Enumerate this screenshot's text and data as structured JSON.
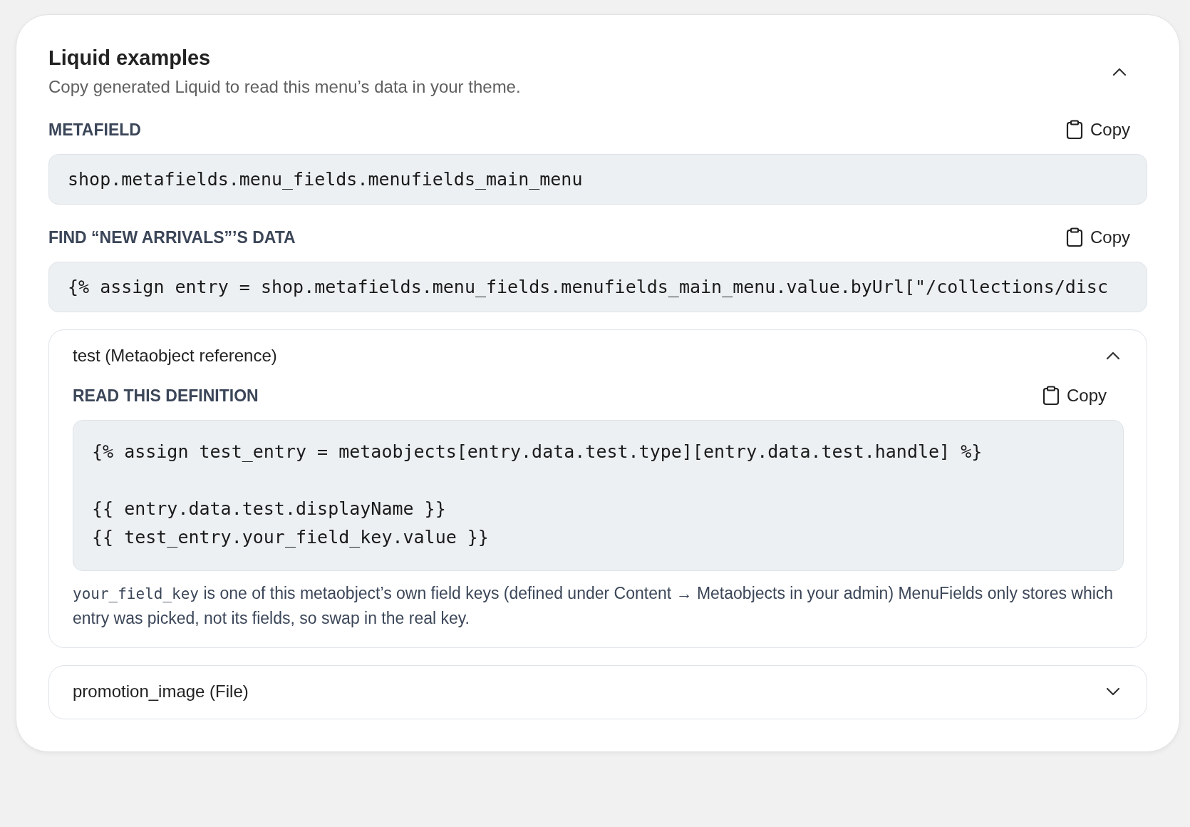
{
  "panel": {
    "title": "Liquid examples",
    "subtitle": "Copy generated Liquid to read this menu’s data in your theme.",
    "expanded": true
  },
  "snippets": [
    {
      "label": "METAFIELD",
      "copy": "Copy",
      "code": "shop.metafields.menu_fields.menufields_main_menu"
    },
    {
      "label": "FIND “NEW ARRIVALS”’S DATA",
      "copy": "Copy",
      "code": "{% assign entry = shop.metafields.menu_fields.menufields_main_menu.value.byUrl[\"/collections/disc"
    }
  ],
  "fields": [
    {
      "title": "test (Metaobject reference)",
      "expanded": true,
      "label": "READ THIS DEFINITION",
      "copy": "Copy",
      "blocks": [
        [
          "{% assign test_entry = metaobjects[entry.data.test.type][entry.data.test.handle] %}"
        ],
        [
          "{{ entry.data.test.displayName }}",
          "{{ test_entry.your_field_key.value }}"
        ]
      ],
      "note_code": "your_field_key",
      "note": " is one of this metaobject’s own field keys (defined under Content → Metaobjects in your admin) MenuFields only stores which entry was picked, not its fields, so swap in the real key."
    },
    {
      "title": "promotion_image (File)",
      "expanded": false
    }
  ]
}
